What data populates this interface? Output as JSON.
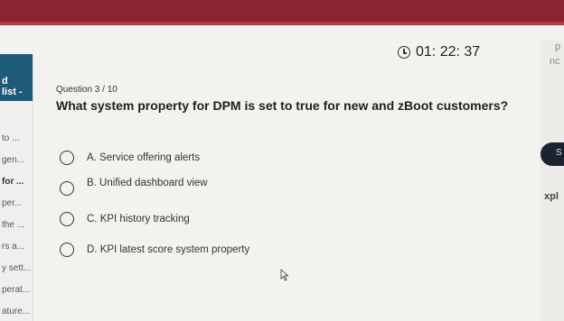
{
  "timer": {
    "value": "01: 22: 37",
    "icon": "clock-icon"
  },
  "left_panel": {
    "header": [
      "d",
      "list -"
    ],
    "items": [
      "to ...",
      "gen...",
      "for ...",
      "per...",
      "the ...",
      "rs a...",
      "y sett...",
      "perat...",
      "ature..."
    ]
  },
  "right_panel": {
    "texts": [
      "p",
      "nc",
      "S",
      "xpl"
    ]
  },
  "question": {
    "counter": "Question 3 / 10",
    "text": "What system property for DPM is set to true for new and zBoot customers?"
  },
  "options": [
    {
      "label": "A. Service offering alerts"
    },
    {
      "label": "B. Unified dashboard view"
    },
    {
      "label": "C. KPI history tracking"
    },
    {
      "label": "D. KPI latest score system property"
    }
  ],
  "colors": {
    "accent": "#1e5a7a",
    "background": "#f3f2ef",
    "text": "#1f1f1f"
  }
}
